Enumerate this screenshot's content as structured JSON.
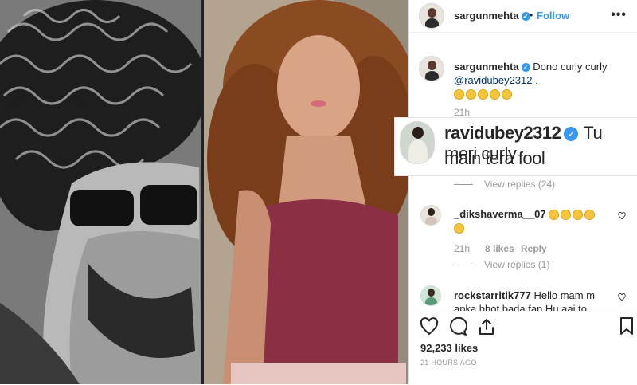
{
  "post": {
    "author": "sargunmehta",
    "follow_label": "Follow",
    "caption_user": "sargunmehta",
    "caption_text": "Dono curly curly",
    "caption_mention": "@ravidubey2312",
    "caption_dot": ".",
    "caption_time": "21h",
    "likes": "92,233 likes",
    "posted": "21 HOURS AGO",
    "more_icon": "more-options-icon",
    "verified_icon": "verified-badge-icon"
  },
  "highlight_comment": {
    "user": "ravidubey2312",
    "line1": "Tu meri curly",
    "line2": "main tera fool",
    "view_replies": "View replies (24)"
  },
  "comments": [
    {
      "user": "_dikshaverma__07",
      "time": "21h",
      "likes": "8 likes",
      "reply": "Reply",
      "view_replies": "View replies (1)"
    },
    {
      "user": "rockstarritik777",
      "text": "Hello mam m",
      "text2": "apka bhot bada fan Hu aai to"
    }
  ],
  "icons": [
    "heart-icon",
    "comment-icon",
    "share-icon",
    "bookmark-icon"
  ],
  "colors": {
    "accent": "#3897f0",
    "text": "#262626",
    "muted": "#999999"
  }
}
